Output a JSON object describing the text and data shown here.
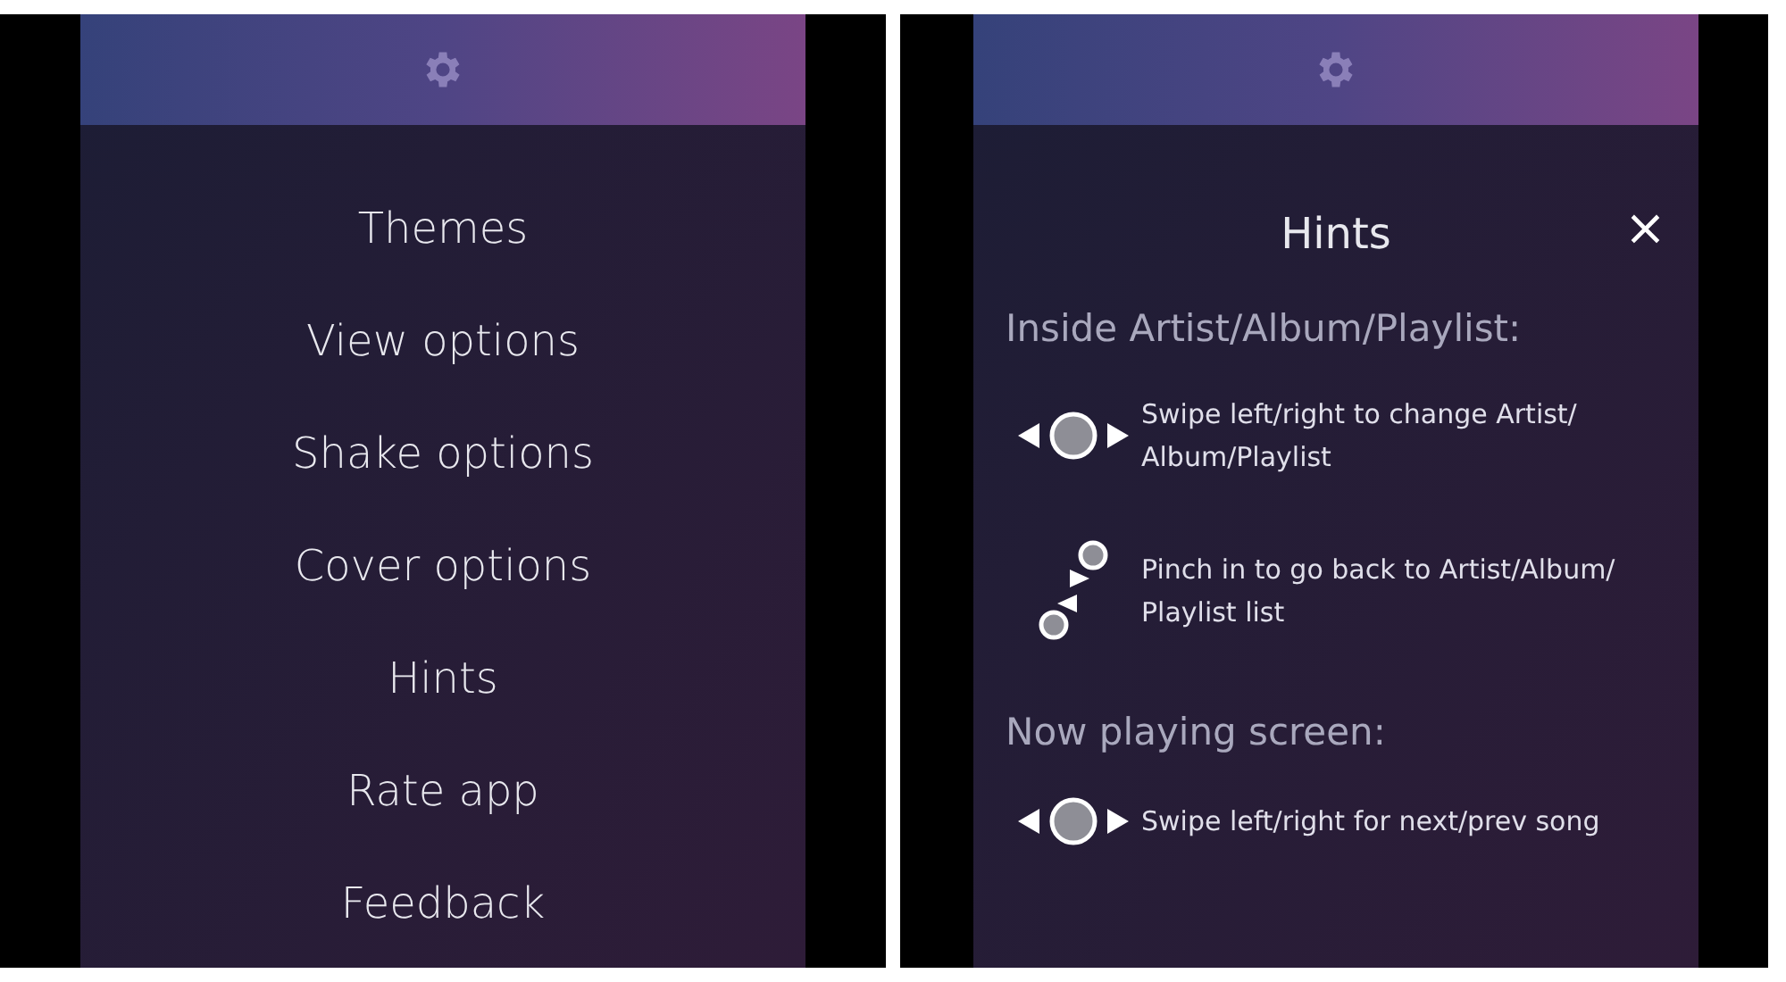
{
  "settings_screen": {
    "menu": [
      {
        "label": "Themes"
      },
      {
        "label": "View options"
      },
      {
        "label": "Shake options"
      },
      {
        "label": "Cover options"
      },
      {
        "label": "Hints"
      },
      {
        "label": "Rate app"
      },
      {
        "label": "Feedback"
      }
    ]
  },
  "hints_screen": {
    "title": "Hints",
    "close": "×",
    "sections": [
      {
        "heading": "Inside Artist/Album/Playlist:",
        "hints": [
          {
            "kind": "swipe",
            "text": "Swipe left/right to change Artist/ Album/Playlist"
          },
          {
            "kind": "pinch",
            "text": "Pinch in to go back to Artist/Album/ Playlist list"
          }
        ]
      },
      {
        "heading": "Now playing screen:",
        "hints": [
          {
            "kind": "swipe",
            "text": "Swipe left/right for next/prev song"
          }
        ]
      }
    ]
  }
}
